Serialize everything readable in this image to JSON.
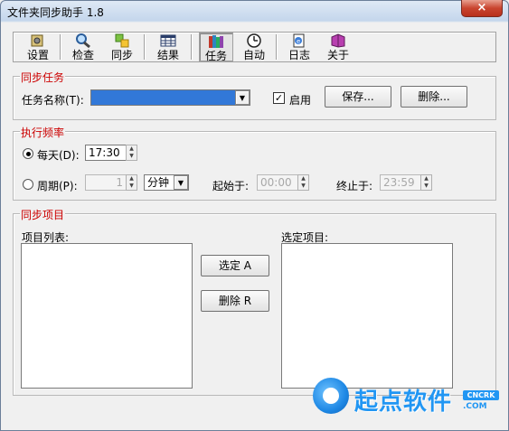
{
  "window": {
    "title": "文件夹同步助手 1.8",
    "close_symbol": "×"
  },
  "toolbar": [
    {
      "label": "设置",
      "icon": "settings-icon"
    },
    {
      "label": "检查",
      "icon": "magnifier-icon"
    },
    {
      "label": "同步",
      "icon": "sync-icon"
    },
    {
      "label": "结果",
      "icon": "table-icon"
    },
    {
      "label": "任务",
      "icon": "books-icon"
    },
    {
      "label": "自动",
      "icon": "clock-icon"
    },
    {
      "label": "日志",
      "icon": "log-icon"
    },
    {
      "label": "关于",
      "icon": "book-icon"
    }
  ],
  "task_group": {
    "title": "同步任务",
    "name_label": "任务名称(T):",
    "name_value": "",
    "enable_label": "启用",
    "enabled": true,
    "save_button": "保存...",
    "delete_button": "删除..."
  },
  "frequency_group": {
    "title": "执行频率",
    "daily_label": "每天(D):",
    "daily_time": "17:30",
    "period_label": "周期(P):",
    "period_value": "1",
    "period_unit": "分钟",
    "start_label": "起始于:",
    "start_time": "00:00",
    "end_label": "终止于:",
    "end_time": "23:59"
  },
  "items_group": {
    "title": "同步项目",
    "list_label": "项目列表:",
    "selected_label": "选定项目:",
    "select_button": "选定 A",
    "remove_button": "删除 R"
  },
  "watermark": {
    "text": "起点软件",
    "badge": "CNCRK",
    "url": ".COM"
  }
}
